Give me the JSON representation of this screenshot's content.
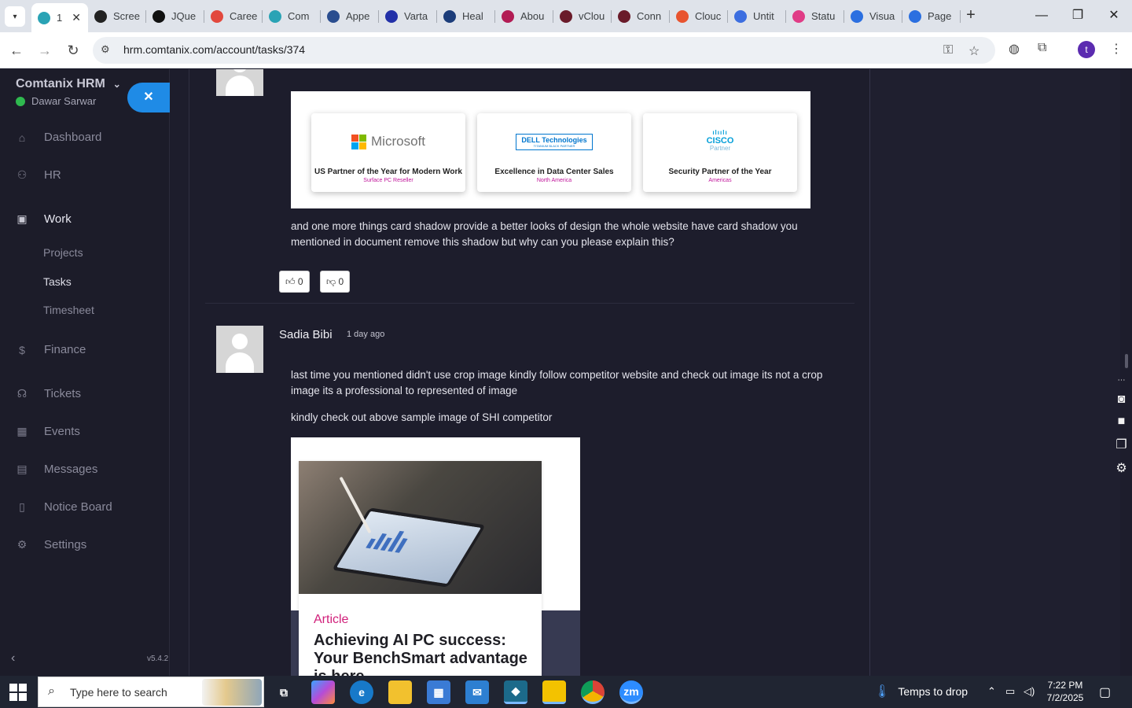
{
  "browser": {
    "tabs": [
      {
        "label": "1",
        "favicon": "comtanix-icon",
        "color": "#2aa3b5",
        "active": true
      },
      {
        "label": "Scree",
        "favicon": "screen-recorder-icon",
        "color": "#222"
      },
      {
        "label": "JQue",
        "favicon": "jquery-icon",
        "color": "#111"
      },
      {
        "label": "Caree",
        "favicon": "careers-icon",
        "color": "#e2483d"
      },
      {
        "label": "Com",
        "favicon": "comtanix-icon",
        "color": "#2aa3b5"
      },
      {
        "label": "Appe",
        "favicon": "app-icon",
        "color": "#2a4d8f"
      },
      {
        "label": "Varta",
        "favicon": "varta-x-icon",
        "color": "#2230a8"
      },
      {
        "label": "Heal",
        "favicon": "health-icon",
        "color": "#1c3d7a"
      },
      {
        "label": "Abou",
        "favicon": "about-icon",
        "color": "#b21c54"
      },
      {
        "label": "vClou",
        "favicon": "v-icon",
        "color": "#6a1b2a"
      },
      {
        "label": "Conn",
        "favicon": "v-icon",
        "color": "#6a1b2a"
      },
      {
        "label": "Clouc",
        "favicon": "cloud-icon",
        "color": "#e8542f"
      },
      {
        "label": "Untit",
        "favicon": "docs-icon",
        "color": "#3c6ee0"
      },
      {
        "label": "Statu",
        "favicon": "status-icon",
        "color": "#e03c86"
      },
      {
        "label": "Visua",
        "favicon": "visual-icon",
        "color": "#2b6fe0"
      },
      {
        "label": "Page",
        "favicon": "pagespeed-icon",
        "color": "#2b6fe0"
      }
    ],
    "url": "hrm.comtanix.com/account/tasks/374",
    "profile_initial": "t"
  },
  "sidebar": {
    "brand": "Comtanix HRM",
    "user": "Dawar Sarwar",
    "nav": [
      {
        "label": "Dashboard",
        "icon": "home-icon"
      },
      {
        "label": "HR",
        "icon": "users-icon"
      },
      {
        "label": "Work",
        "icon": "briefcase-icon"
      },
      {
        "label": "Finance",
        "icon": "dollar-icon"
      },
      {
        "label": "Tickets",
        "icon": "headset-icon"
      },
      {
        "label": "Events",
        "icon": "calendar-icon"
      },
      {
        "label": "Messages",
        "icon": "chat-icon"
      },
      {
        "label": "Notice Board",
        "icon": "clipboard-icon"
      },
      {
        "label": "Settings",
        "icon": "gear-icon"
      }
    ],
    "work_sub": [
      {
        "label": "Projects"
      },
      {
        "label": "Tasks"
      },
      {
        "label": "Timesheet"
      }
    ],
    "version": "v5.4.2"
  },
  "partners": [
    {
      "brand": "Microsoft",
      "title": "US Partner of the Year for Modern Work",
      "subtitle": "Surface PC Reseller"
    },
    {
      "brand": "DELL Technologies",
      "brand_sub": "TITANIUM BLACK PARTNER",
      "title": "Excellence in Data Center Sales",
      "subtitle": "North America"
    },
    {
      "brand": "CISCO",
      "brand_sub": "Partner",
      "title": "Security Partner of the Year",
      "subtitle": "Americas"
    }
  ],
  "comment1": {
    "text": "and one more things card shadow provide a better looks of design the whole website have card shadow you mentioned in document remove this shadow but why can you please explain this?",
    "likes": "0",
    "dislikes": "0"
  },
  "comment2": {
    "author": "Sadia Bibi",
    "time": "1 day ago",
    "text1": "last time you mentioned didn't use crop image kindly follow competitor website and check out image its not a crop image its a professional to represented of image",
    "text2": "kindly check out above sample image of SHI competitor",
    "article_kicker": "Article",
    "article_title": "Achieving AI PC success: Your BenchSmart advantage is here"
  },
  "taskbar": {
    "search_placeholder": "Type here to search",
    "weather": "Temps to drop",
    "time": "7:22 PM",
    "date": "7/2/2025"
  }
}
